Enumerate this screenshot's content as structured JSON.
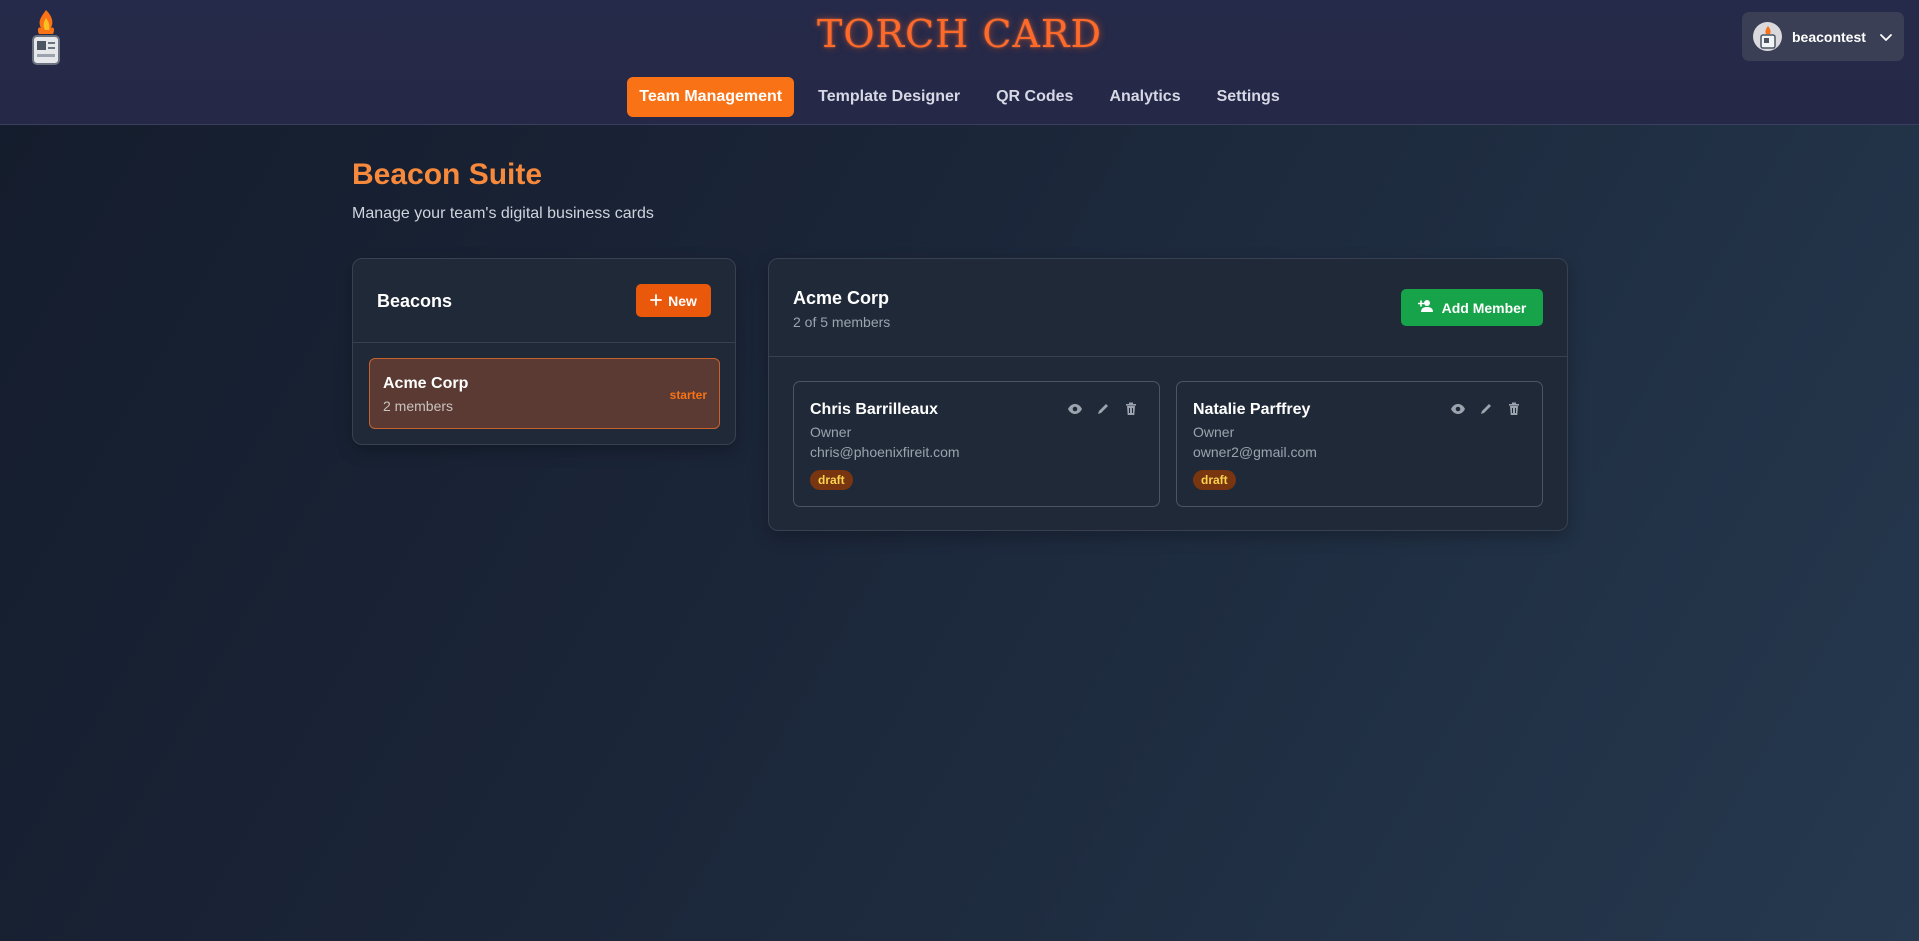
{
  "header": {
    "brand": "TORCH CARD",
    "logo_icon": "torch-card-logo-icon",
    "nav": [
      {
        "label": "Team Management",
        "active": true
      },
      {
        "label": "Template Designer",
        "active": false
      },
      {
        "label": "QR Codes",
        "active": false
      },
      {
        "label": "Analytics",
        "active": false
      },
      {
        "label": "Settings",
        "active": false
      }
    ],
    "user": {
      "name": "beacontest",
      "icon": "chevron-down-icon"
    }
  },
  "page": {
    "title": "Beacon Suite",
    "subtitle": "Manage your team's digital business cards"
  },
  "beacons": {
    "title": "Beacons",
    "new_label": "New",
    "items": [
      {
        "name": "Acme Corp",
        "members": "2 members",
        "plan": "starter"
      }
    ]
  },
  "team": {
    "name": "Acme Corp",
    "count": "2 of 5 members",
    "add_label": "Add Member",
    "members": [
      {
        "name": "Chris Barrilleaux",
        "role": "Owner",
        "email": "chris@phoenixfireit.com",
        "status": "draft"
      },
      {
        "name": "Natalie Parffrey",
        "role": "Owner",
        "email": "owner2@gmail.com",
        "status": "draft"
      }
    ]
  },
  "colors": {
    "accent": "#f97316",
    "success": "#16a34a",
    "brand_glow": "#ff6a2b"
  }
}
